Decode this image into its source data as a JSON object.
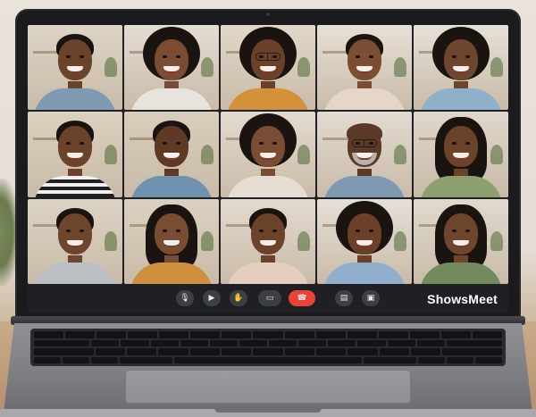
{
  "app": {
    "brand": "ShowsMeet"
  },
  "toolbar": {
    "buttons": [
      {
        "name": "mic-button",
        "icon": "microphone-icon",
        "glyph": "🎙",
        "left": 0
      },
      {
        "name": "camera-button",
        "icon": "video-camera-icon",
        "glyph": "▶",
        "left": 0
      },
      {
        "name": "raise-hand-button",
        "icon": "hand-icon",
        "glyph": "✋",
        "left": 0
      },
      {
        "name": "share-screen-button",
        "icon": "present-screen-icon",
        "glyph": "▭",
        "left": 0
      },
      {
        "name": "end-call-button",
        "icon": "hang-up-icon",
        "glyph": "☎",
        "left": 0,
        "danger": true
      },
      {
        "name": "chat-button",
        "icon": "chat-icon",
        "glyph": "▤",
        "left": 0
      },
      {
        "name": "more-options-button",
        "icon": "more-options-icon",
        "glyph": "▣",
        "left": 0
      }
    ],
    "end_call_color": "#ea4335"
  },
  "participants": [
    {
      "hair": "short",
      "skin": "#6b432b",
      "shirt": "#7f9bb3",
      "room": "#ddd4c6"
    },
    {
      "hair": "curly",
      "skin": "#7a4c31",
      "shirt": "#e8e3dc",
      "room": "#e3ddd3"
    },
    {
      "hair": "curly",
      "skin": "#6a4029",
      "shirt": "#d3913a",
      "room": "#e1d8ca",
      "glasses": true
    },
    {
      "hair": "short",
      "skin": "#7b4d33",
      "shirt": "#e6d6c7",
      "room": "#e7e0d6"
    },
    {
      "hair": "curly",
      "skin": "#6e452d",
      "shirt": "#8fb0cb",
      "room": "#e5e0d8"
    },
    {
      "hair": "short",
      "skin": "#6b432b",
      "shirt": "#2a2a2a",
      "room": "#dcd0bf",
      "stripes": true
    },
    {
      "hair": "short",
      "skin": "#5e3a25",
      "shirt": "#6f92b0",
      "room": "#d9cdbb"
    },
    {
      "hair": "curly",
      "skin": "#7a4c31",
      "shirt": "#e6ddd2",
      "room": "#e3dbcf"
    },
    {
      "hair": "bald",
      "skin": "#5a3926",
      "shirt": "#7e9ab3",
      "room": "#e2dbd0",
      "glasses": true,
      "beard": true
    },
    {
      "hair": "long",
      "skin": "#6b432b",
      "shirt": "#8ea06f",
      "room": "#dfd8cc"
    },
    {
      "hair": "short",
      "skin": "#6e452d",
      "shirt": "#b9bfc2",
      "room": "#ddd3c4"
    },
    {
      "hair": "long",
      "skin": "#7a4c31",
      "shirt": "#cf8f3c",
      "room": "#dcd1c1"
    },
    {
      "hair": "short",
      "skin": "#6b432b",
      "shirt": "#e4cfbe",
      "room": "#e3dad0"
    },
    {
      "hair": "curly",
      "skin": "#6a4029",
      "shirt": "#8eaecb",
      "room": "#e6e0d8"
    },
    {
      "hair": "long",
      "skin": "#6e452d",
      "shirt": "#728a5e",
      "room": "#e0dacf"
    }
  ]
}
